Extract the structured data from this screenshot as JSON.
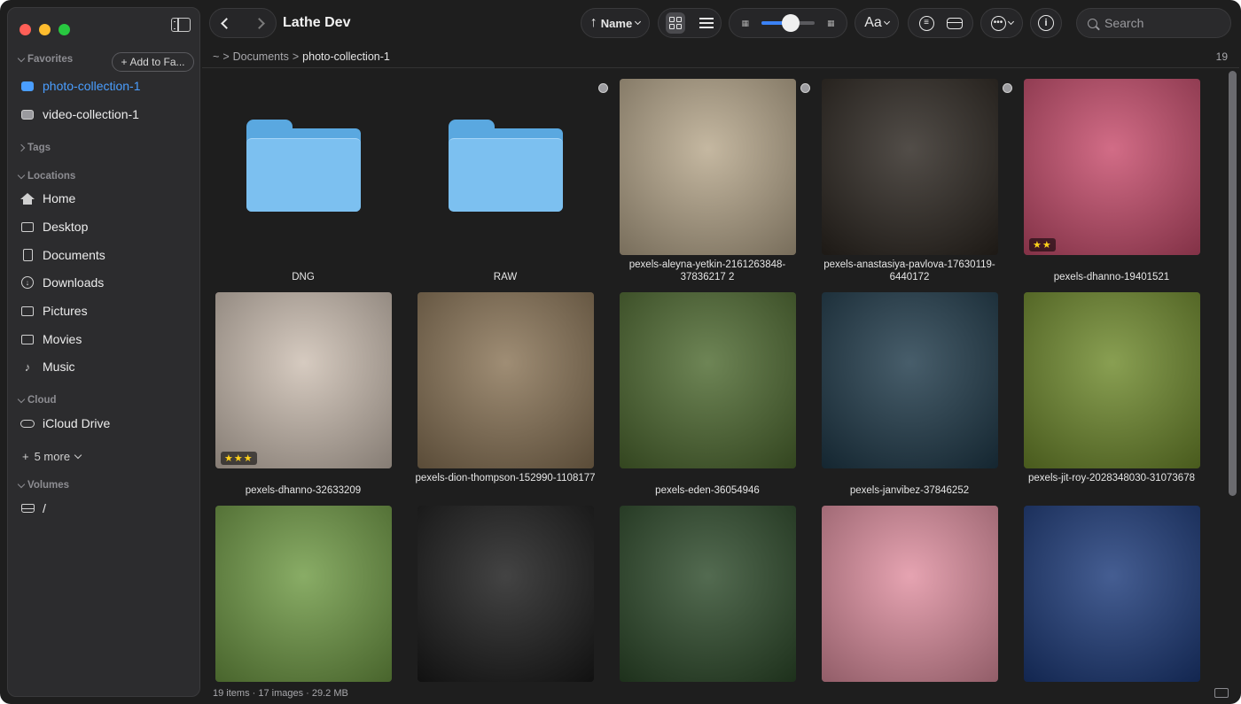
{
  "window": {
    "title": "Lathe Dev"
  },
  "sidebar": {
    "favorites_label": "Favorites",
    "add_fav_label": "Add to Fa...",
    "favorites": [
      {
        "label": "photo-collection-1",
        "icon": "photo-stack-icon",
        "selected": true
      },
      {
        "label": "video-collection-1",
        "icon": "film-icon",
        "selected": false
      }
    ],
    "tags_label": "Tags",
    "locations_label": "Locations",
    "locations": [
      {
        "label": "Home",
        "icon": "house-icon"
      },
      {
        "label": "Desktop",
        "icon": "desktop-icon"
      },
      {
        "label": "Documents",
        "icon": "document-icon"
      },
      {
        "label": "Downloads",
        "icon": "download-icon"
      },
      {
        "label": "Pictures",
        "icon": "photo-icon"
      },
      {
        "label": "Movies",
        "icon": "film-icon"
      },
      {
        "label": "Music",
        "icon": "music-note-icon"
      }
    ],
    "cloud_label": "Cloud",
    "cloud": [
      {
        "label": "iCloud Drive",
        "icon": "cloud-icon"
      }
    ],
    "more_label": "5 more",
    "volumes_label": "Volumes",
    "volumes": [
      {
        "label": "/",
        "icon": "drive-icon"
      }
    ]
  },
  "toolbar": {
    "sort_label": "Name",
    "font_label": "Aa",
    "search_placeholder": "Search",
    "zoom_fraction": 0.55
  },
  "breadcrumb": {
    "root": "~",
    "parent": "Documents",
    "current": "photo-collection-1",
    "sep": ">"
  },
  "item_count": "19",
  "status_text": "19 items · 17 images · 29.2 MB",
  "grid": [
    {
      "type": "folder",
      "name": "DNG"
    },
    {
      "type": "folder",
      "name": "RAW"
    },
    {
      "type": "image",
      "name": "pexels-aleyna-yetkin-2161263848-37836217 2",
      "dot": true,
      "bg": "#b8a88c"
    },
    {
      "type": "image",
      "name": "pexels-anastasiya-pavlova-17630119-6440172",
      "dot": true,
      "bg": "#2c2620"
    },
    {
      "type": "image",
      "name": "pexels-dhanno-19401521",
      "dot": true,
      "bg": "#c84c6c",
      "stars": "★★"
    },
    {
      "type": "image",
      "name": "pexels-dhanno-32633209",
      "bg": "#cdbfb2",
      "stars": "★★★"
    },
    {
      "type": "image",
      "name": "pexels-dion-thompson-152990-1108177",
      "bg": "#8a7456"
    },
    {
      "type": "image",
      "name": "pexels-eden-36054946",
      "bg": "#4e6a30"
    },
    {
      "type": "image",
      "name": "pexels-janvibez-37846252",
      "bg": "#1f3a4a"
    },
    {
      "type": "image",
      "name": "pexels-jit-roy-2028348030-31073678",
      "bg": "#6f8a2c"
    },
    {
      "type": "image",
      "name": "",
      "bg": "#6f9a44"
    },
    {
      "type": "image",
      "name": "",
      "bg": "#1a1a1a"
    },
    {
      "type": "image",
      "name": "",
      "bg": "#2d4a2a"
    },
    {
      "type": "image",
      "name": "",
      "bg": "#e08fa0"
    },
    {
      "type": "image",
      "name": "",
      "bg": "#1c3a7a"
    }
  ]
}
